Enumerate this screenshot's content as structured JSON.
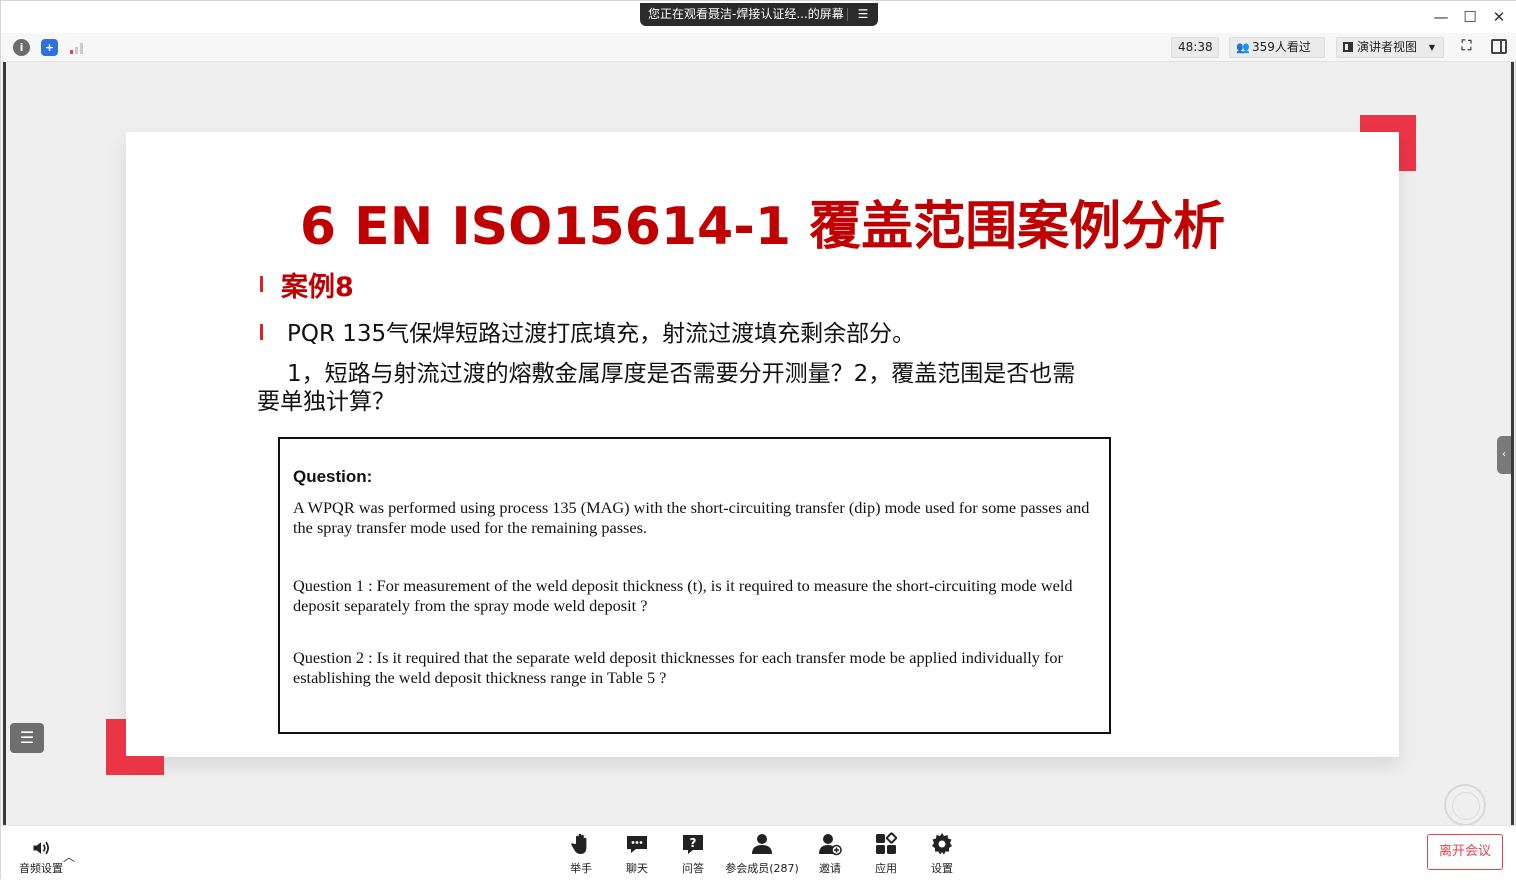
{
  "titlebar": {
    "sharing_text": "您正在观看聂洁-焊接认证经...的屏幕",
    "menu_icon": "list-menu-icon",
    "buttons": [
      "minimize",
      "maximize",
      "close"
    ]
  },
  "toolbar": {
    "timer": "48:38",
    "viewers": "359人看过",
    "view_mode": "演讲者视图",
    "icons": [
      "info-icon",
      "shield-icon",
      "signal-icon",
      "fullscreen-icon",
      "sidebar-toggle-icon"
    ]
  },
  "slide": {
    "title": "6 EN ISO15614-1 覆盖范围案例分析",
    "case_label": "案例8",
    "line1": "PQR 135气保焊短路过渡打底填充，射流过渡填充剩余部分。",
    "line2": "1，短路与射流过渡的熔敷金属厚度是否需要分开测量？2，覆盖范围是否也需要单独计算？",
    "box": {
      "heading": "Question:",
      "paragraph1": "A WPQR was performed using process 135 (MAG) with the short-circuiting transfer (dip) mode used for some passes and the spray transfer mode used for the remaining passes.",
      "paragraph2": "Question 1 :  For measurement of the weld deposit thickness (t), is it required to measure the short-circuiting mode weld deposit separately from the spray mode weld deposit ?",
      "paragraph3": "Question 2 :  Is it required that the separate weld deposit thicknesses for each transfer mode be applied individually for establishing the weld deposit thickness range in Table 5 ?"
    },
    "accent_color": "#c00000",
    "corner_color": "#ea3547"
  },
  "bottombar": {
    "audio_label": "音频设置",
    "items": [
      {
        "label": "举手",
        "icon": "raise-hand-icon"
      },
      {
        "label": "聊天",
        "icon": "chat-icon"
      },
      {
        "label": "问答",
        "icon": "qa-icon"
      },
      {
        "label": "参会成员(287)",
        "icon": "participants-icon"
      },
      {
        "label": "邀请",
        "icon": "invite-icon"
      },
      {
        "label": "应用",
        "icon": "apps-icon"
      },
      {
        "label": "设置",
        "icon": "settings-icon"
      }
    ],
    "leave_label": "离开会议"
  }
}
